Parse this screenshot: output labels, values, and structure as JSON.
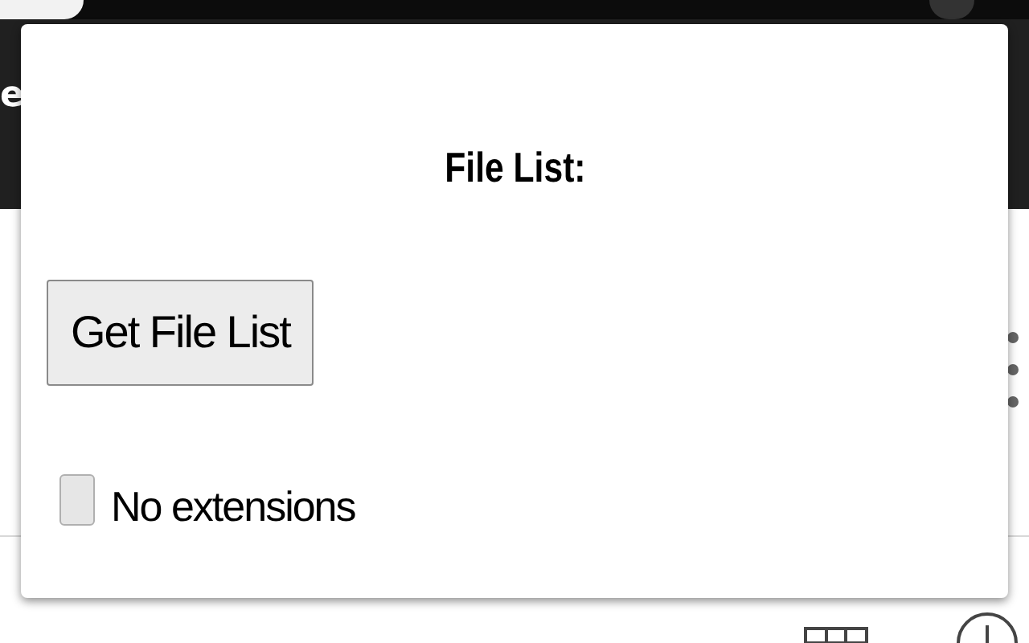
{
  "background": {
    "cut_text": "e"
  },
  "popup": {
    "title": "File List:",
    "button": "Get File List",
    "options": [
      {
        "kind": "checkbox",
        "label": "No extensions",
        "checked": false
      }
    ]
  }
}
